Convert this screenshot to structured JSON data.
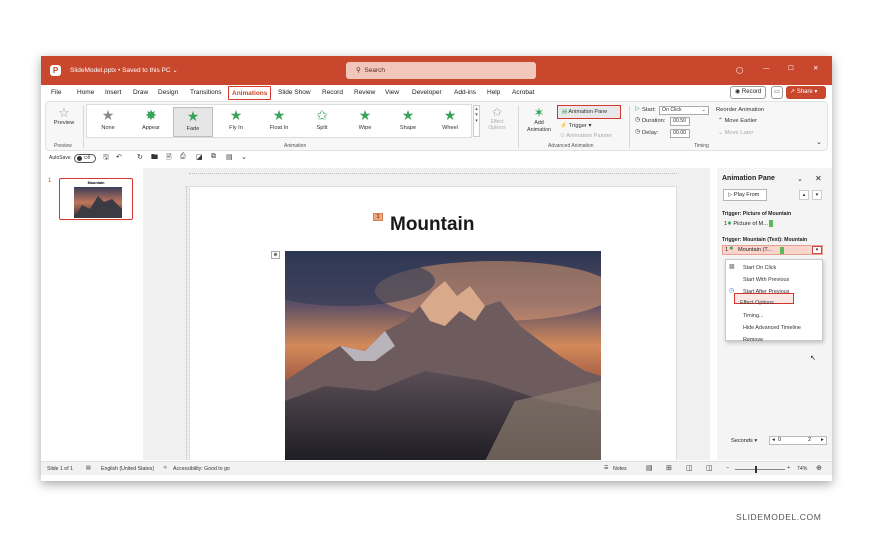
{
  "window": {
    "file_label": "SlideModel.pptx • Saved to this PC ⌄",
    "search_placeholder": "Search"
  },
  "tabs": [
    "File",
    "Home",
    "Insert",
    "Draw",
    "Design",
    "Transitions",
    "Animations",
    "Slide Show",
    "Record",
    "Review",
    "View",
    "Developer",
    "Add-ins",
    "Help",
    "Acrobat"
  ],
  "active_tab": "Animations",
  "header_buttons": {
    "record": "Record",
    "share": "Share"
  },
  "ribbon": {
    "preview": "Preview",
    "preview_group": "Preview",
    "effects": [
      "None",
      "Appear",
      "Fade",
      "Fly In",
      "Float In",
      "Split",
      "Wipe",
      "Shape",
      "Wheel"
    ],
    "selected_effect": "Fade",
    "effect_options": "Effect Options",
    "animation_group": "Animation",
    "add_animation": "Add Animation",
    "animation_pane": "Animation Pane",
    "trigger": "Trigger",
    "animation_painter": "Animation Painter",
    "advanced_group": "Advanced Animation",
    "start_label": "Start:",
    "start_value": "On Click",
    "duration_label": "Duration:",
    "duration_value": "00.50",
    "delay_label": "Delay:",
    "delay_value": "00.00",
    "reorder": "Reorder Animation",
    "move_earlier": "Move Earlier",
    "move_later": "Move Later",
    "timing_group": "Timing"
  },
  "qat": {
    "autosave": "AutoSave",
    "autosave_state": "Off"
  },
  "thumbnails": [
    {
      "number": "1",
      "title": "Mountain"
    }
  ],
  "slide": {
    "title": "Mountain"
  },
  "pane": {
    "title": "Animation Pane",
    "play_from": "Play From",
    "trigger1": "Trigger: Picture of Mountain",
    "item1": "Picture of M...",
    "trigger2": "Trigger: Mountain (Text): Mountain",
    "item2": "Mountain (T...",
    "menu": [
      "Start On Click",
      "Start With Previous",
      "Start After Previous",
      "Effect Options...",
      "Timing...",
      "Hide Advanced Timeline",
      "Remove"
    ],
    "highlighted": "Effect Options...",
    "seconds": "Seconds",
    "timeline_0": "0",
    "timeline_2": "2"
  },
  "status": {
    "slide": "Slide 1 of 1",
    "language": "English (United States)",
    "accessibility": "Accessibility: Good to go",
    "notes": "Notes",
    "zoom": "74%"
  },
  "watermark": "SLIDEMODEL.COM",
  "colors": {
    "accent": "#c8472d",
    "highlight": "#d6362c",
    "star": "#3aa35a"
  }
}
